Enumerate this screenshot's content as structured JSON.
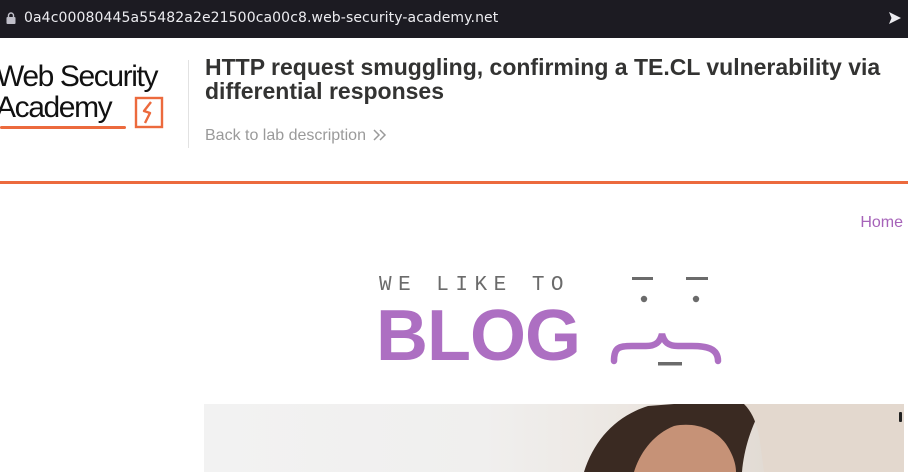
{
  "browser": {
    "url": "0a4c00080445a55482a2e21500ca00c8.web-security-academy.net",
    "lock_icon": "lock-icon",
    "go_icon": "arrow-right-icon",
    "bar_color": "#1c1b22"
  },
  "header": {
    "logo_line1": "Web Security",
    "logo_line2": "Academy",
    "title": "HTTP request smuggling, confirming a TE.CL vulnerability via differential responses",
    "back_link": "Back to lab description",
    "accent_color": "#ec6a3d"
  },
  "nav": {
    "home": "Home",
    "link_color": "#a663b9"
  },
  "banner": {
    "tagline": "WE LIKE TO",
    "word": "BLOG",
    "word_color": "#ad6fc2"
  }
}
